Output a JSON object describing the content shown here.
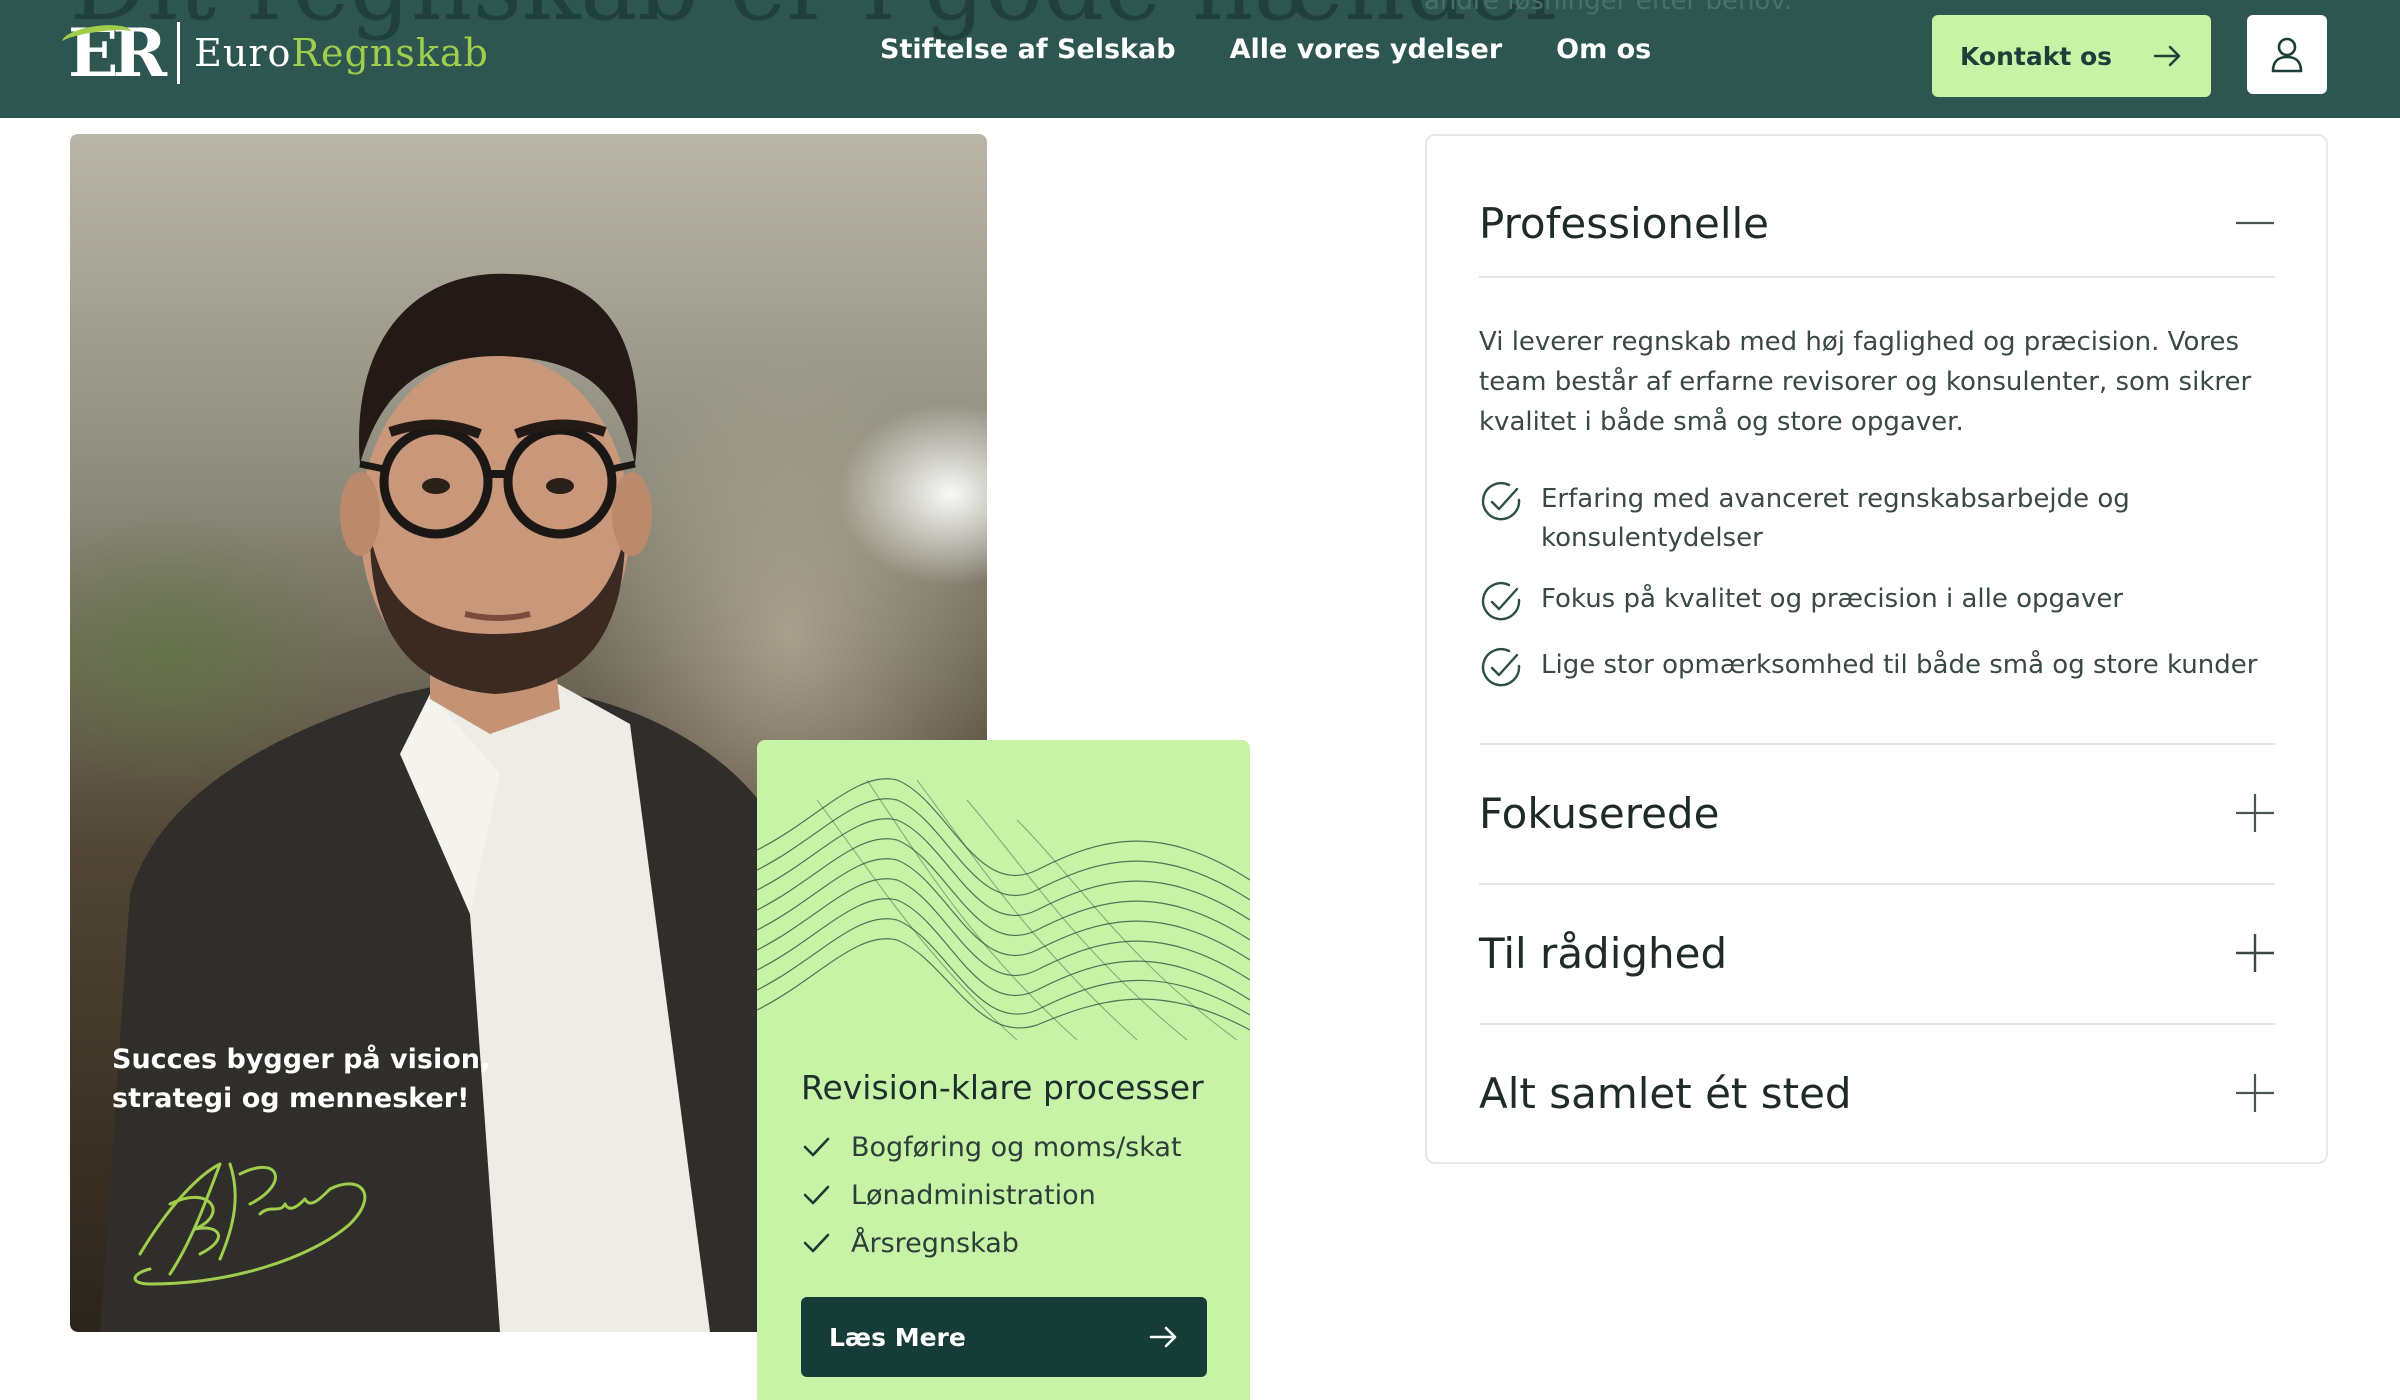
{
  "header": {
    "ghost_heading": "Dit regnskab er i gode hænder",
    "ghost_subtext": "andre løsninger efter behov.",
    "logo": {
      "mark": "ER",
      "text_part1": "Euro",
      "text_part2": "Regnskab"
    },
    "nav": [
      {
        "label": "Stiftelse af Selskab"
      },
      {
        "label": "Alle vores ydelser"
      },
      {
        "label": "Om os"
      }
    ],
    "contact_button": {
      "label": "Kontakt os",
      "icon": "arrow-right-icon"
    },
    "user_button": {
      "icon": "user-icon"
    }
  },
  "hero": {
    "caption": "Succes bygger på vision, strategi og mennesker!",
    "signature_icon": "signature-icon"
  },
  "process_card": {
    "title": "Revision-klare processer",
    "items": [
      "Bogføring og moms/skat",
      "Lønadministration",
      "Årsregnskab"
    ],
    "button_label": "Læs Mere",
    "bg_color": "#c6f3a5"
  },
  "accordion": {
    "open": {
      "title": "Professionelle",
      "text": "Vi leverer regnskab med høj faglighed og præcision. Vores team består af erfarne revisorer og konsulenter, som sikrer kvalitet i både små og store opgaver.",
      "features": [
        "Erfaring med avanceret regnskabsarbejde og konsulentydelser",
        "Fokus på kvalitet og præcision i alle opgaver",
        "Lige stor opmærksomhed til både små og store kunder"
      ]
    },
    "collapsed": [
      {
        "title": "Fokuserede"
      },
      {
        "title": "Til rådighed"
      },
      {
        "title": "Alt samlet ét sted"
      }
    ]
  },
  "colors": {
    "header_bg": "#2e5650",
    "accent_green": "#c6f3a5",
    "dark_green": "#163c37",
    "logo_green": "#9fce4d"
  }
}
